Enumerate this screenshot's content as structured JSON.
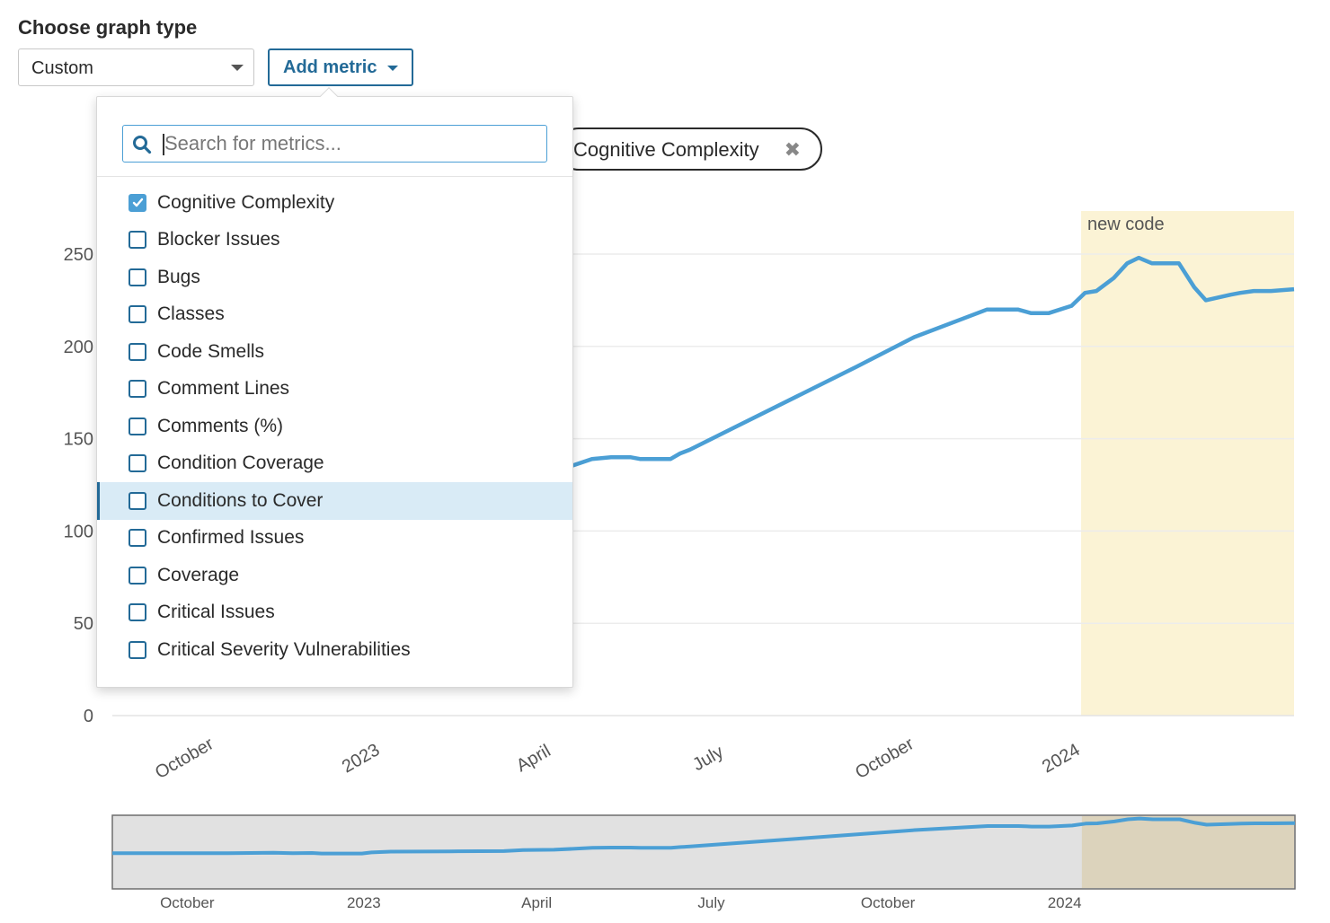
{
  "header": {
    "title": "Choose graph type",
    "graph_type_select": {
      "value": "Custom",
      "icon": "chevron-down-icon"
    },
    "add_metric_button": {
      "label": "Add metric",
      "icon": "caret-down-icon"
    }
  },
  "selected_metric_chip": {
    "label": "Cognitive Complexity",
    "remove_icon": "close-icon"
  },
  "metric_dropdown": {
    "search": {
      "value": "",
      "placeholder": "Search for metrics...",
      "icon": "search-icon"
    },
    "items": [
      {
        "label": "Cognitive Complexity",
        "checked": true,
        "active": false
      },
      {
        "label": "Blocker Issues",
        "checked": false,
        "active": false
      },
      {
        "label": "Bugs",
        "checked": false,
        "active": false
      },
      {
        "label": "Classes",
        "checked": false,
        "active": false
      },
      {
        "label": "Code Smells",
        "checked": false,
        "active": false
      },
      {
        "label": "Comment Lines",
        "checked": false,
        "active": false
      },
      {
        "label": "Comments (%)",
        "checked": false,
        "active": false
      },
      {
        "label": "Condition Coverage",
        "checked": false,
        "active": false
      },
      {
        "label": "Conditions to Cover",
        "checked": false,
        "active": true
      },
      {
        "label": "Confirmed Issues",
        "checked": false,
        "active": false
      },
      {
        "label": "Coverage",
        "checked": false,
        "active": false
      },
      {
        "label": "Critical Issues",
        "checked": false,
        "active": false
      },
      {
        "label": "Critical Severity Vulnerabilities",
        "checked": false,
        "active": false
      }
    ]
  },
  "colors": {
    "line": "#4b9fd5",
    "accent": "#236a97",
    "new_code_band": "#fbf3d5",
    "navigator_bg": "#e1e1e1",
    "navigator_band": "#dcd3bc"
  },
  "chart_data": {
    "type": "line",
    "title": "",
    "xlabel": "",
    "ylabel": "",
    "series": [
      {
        "name": "Cognitive Complexity",
        "points": [
          [
            "2022-08-23",
            119
          ],
          [
            "2022-09-20",
            119
          ],
          [
            "2022-10-20",
            119
          ],
          [
            "2022-11-15",
            121
          ],
          [
            "2022-11-25",
            119
          ],
          [
            "2022-12-05",
            120
          ],
          [
            "2022-12-10",
            118
          ],
          [
            "2022-12-31",
            118
          ],
          [
            "2023-01-05",
            122
          ],
          [
            "2023-01-15",
            125
          ],
          [
            "2023-02-15",
            126
          ],
          [
            "2023-03-15",
            127
          ],
          [
            "2023-03-25",
            131
          ],
          [
            "2023-04-10",
            132
          ],
          [
            "2023-04-30",
            139
          ],
          [
            "2023-05-10",
            140
          ],
          [
            "2023-05-20",
            140
          ],
          [
            "2023-05-25",
            139
          ],
          [
            "2023-06-10",
            139
          ],
          [
            "2023-06-15",
            142
          ],
          [
            "2023-06-20",
            144
          ],
          [
            "2023-07-15",
            157
          ],
          [
            "2023-08-15",
            173
          ],
          [
            "2023-09-15",
            189
          ],
          [
            "2023-10-15",
            205
          ],
          [
            "2023-11-22",
            220
          ],
          [
            "2023-12-08",
            220
          ],
          [
            "2023-12-15",
            218
          ],
          [
            "2023-12-24",
            218
          ],
          [
            "2024-01-05",
            222
          ],
          [
            "2024-01-12",
            229
          ],
          [
            "2024-01-18",
            230
          ],
          [
            "2024-01-27",
            237
          ],
          [
            "2024-02-03",
            245
          ],
          [
            "2024-02-09",
            248
          ],
          [
            "2024-02-16",
            245
          ],
          [
            "2024-03-01",
            245
          ],
          [
            "2024-03-09",
            232
          ],
          [
            "2024-03-15",
            225
          ],
          [
            "2024-03-28",
            228
          ],
          [
            "2024-04-02",
            229
          ],
          [
            "2024-04-09",
            230
          ],
          [
            "2024-04-18",
            230
          ],
          [
            "2024-04-30",
            231
          ]
        ]
      }
    ],
    "x_range": [
      "2022-08-23",
      "2024-04-30"
    ],
    "y_range": [
      0,
      250
    ],
    "y_ticks": [
      0,
      50,
      100,
      150,
      200,
      250
    ],
    "x_ticks": [
      {
        "date": "2022-10-01",
        "label": "October"
      },
      {
        "date": "2023-01-01",
        "label": "2023"
      },
      {
        "date": "2023-04-01",
        "label": "April"
      },
      {
        "date": "2023-07-01",
        "label": "July"
      },
      {
        "date": "2023-10-01",
        "label": "October"
      },
      {
        "date": "2024-01-01",
        "label": "2024"
      }
    ],
    "grid": true,
    "legend": "none",
    "annotations": [
      {
        "type": "band",
        "label": "new code",
        "from": "2024-01-10",
        "to": "2024-04-30"
      }
    ],
    "navigator": {
      "x_ticks": [
        {
          "date": "2022-10-01",
          "label": "October"
        },
        {
          "date": "2023-01-01",
          "label": "2023"
        },
        {
          "date": "2023-04-01",
          "label": "April"
        },
        {
          "date": "2023-07-01",
          "label": "July"
        },
        {
          "date": "2023-10-01",
          "label": "October"
        },
        {
          "date": "2024-01-01",
          "label": "2024"
        }
      ]
    }
  }
}
